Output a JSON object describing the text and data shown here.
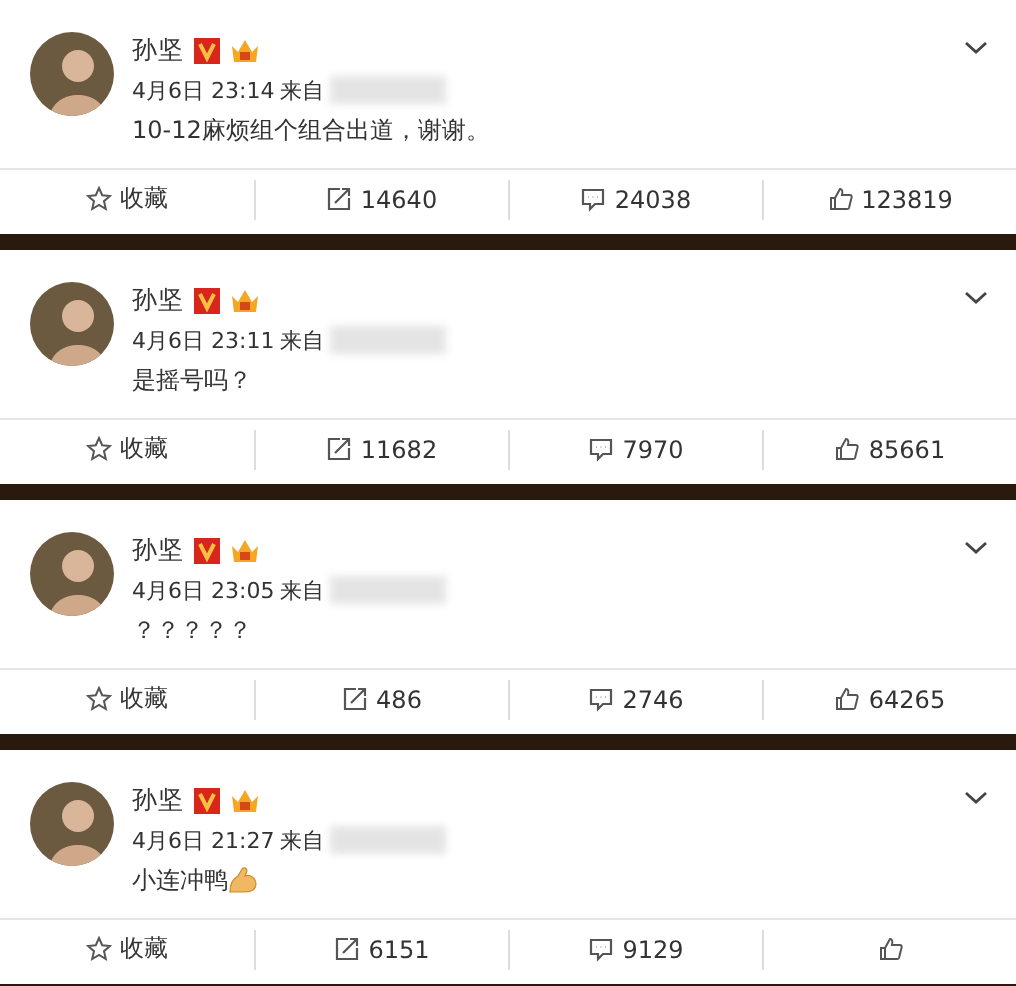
{
  "posts": [
    {
      "author": "孙坚",
      "time": "4月6日 23:14",
      "source_label": "来自",
      "text": "10-12麻烦组个组合出道，谢谢。",
      "has_emoji": false,
      "actions": {
        "favorite": "收藏",
        "repost": "14640",
        "comment": "24038",
        "like": "123819"
      }
    },
    {
      "author": "孙坚",
      "time": "4月6日 23:11",
      "source_label": "来自",
      "text": "是摇号吗？",
      "has_emoji": false,
      "actions": {
        "favorite": "收藏",
        "repost": "11682",
        "comment": "7970",
        "like": "85661"
      }
    },
    {
      "author": "孙坚",
      "time": "4月6日 23:05",
      "source_label": "来自",
      "text": "？？？？？",
      "has_emoji": false,
      "actions": {
        "favorite": "收藏",
        "repost": "486",
        "comment": "2746",
        "like": "64265"
      }
    },
    {
      "author": "孙坚",
      "time": "4月6日 21:27",
      "source_label": "来自",
      "text": "小连冲鸭",
      "has_emoji": true,
      "actions": {
        "favorite": "收藏",
        "repost": "6151",
        "comment": "9129"
      }
    }
  ]
}
